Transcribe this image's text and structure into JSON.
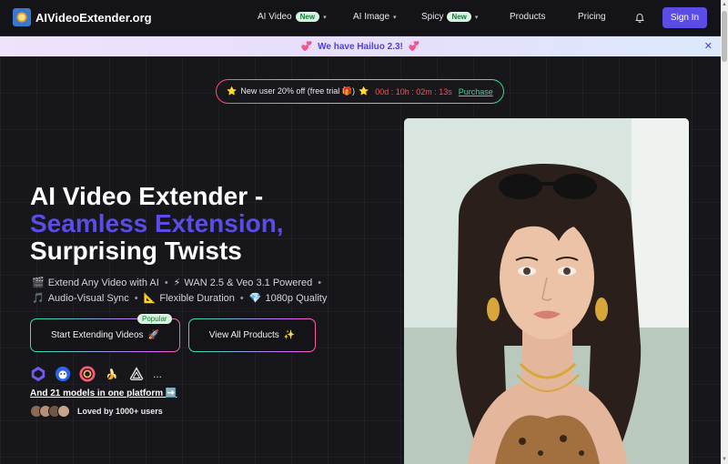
{
  "nav": {
    "logo_text": "AIVideoExtender.org",
    "items": [
      {
        "label": "AI Video",
        "badge": "New",
        "has_chevron": true
      },
      {
        "label": "AI Image",
        "badge": "",
        "has_chevron": true
      },
      {
        "label": "Spicy",
        "badge": "New",
        "has_chevron": true
      },
      {
        "label": "Products",
        "badge": "",
        "has_chevron": false
      },
      {
        "label": "Pricing",
        "badge": "",
        "has_chevron": false
      }
    ],
    "bell_icon": "bell-icon",
    "sign_in_label": "Sign In",
    "accent_color": "#5b4ce6"
  },
  "announcement": {
    "text": "We have Hailuo 2.3!",
    "left_emoji": "💞",
    "right_emoji": "💞",
    "close_icon": "close-icon",
    "text_color": "#4f3fe0"
  },
  "promo": {
    "prefix_emoji": "⭐",
    "text": "New user 20% off (free trial 🎁)",
    "suffix_emoji": "⭐",
    "timer": "00d : 10h : 02m : 13s",
    "link_label": "Purchase"
  },
  "hero": {
    "title_line1": "AI Video Extender -",
    "title_line2": "Seamless Extension,",
    "title_line3": "Surprising Twists",
    "features_row1": [
      {
        "icon": "🎬",
        "text": "Extend Any Video with AI"
      },
      {
        "icon": "⚡",
        "text": "WAN 2.5 & Veo 3.1 Powered"
      }
    ],
    "features_row2": [
      {
        "icon": "🎵",
        "text": "Audio-Visual Sync"
      },
      {
        "icon": "📐",
        "text": "Flexible Duration"
      },
      {
        "icon": "💎",
        "text": "1080p Quality"
      }
    ],
    "primary_button": "Start Extending Videos",
    "primary_button_emoji": "🚀",
    "popular_badge": "Popular",
    "secondary_button": "View All Products",
    "secondary_button_emoji": "✨",
    "model_icons": [
      "kling-icon",
      "cloud-face-icon",
      "spiral-icon",
      "banana-icon",
      "triangle-icon"
    ],
    "more": "...",
    "models_link": "And 21 models in one platform ➡️",
    "users_text": "Loved by 1000+ users"
  }
}
